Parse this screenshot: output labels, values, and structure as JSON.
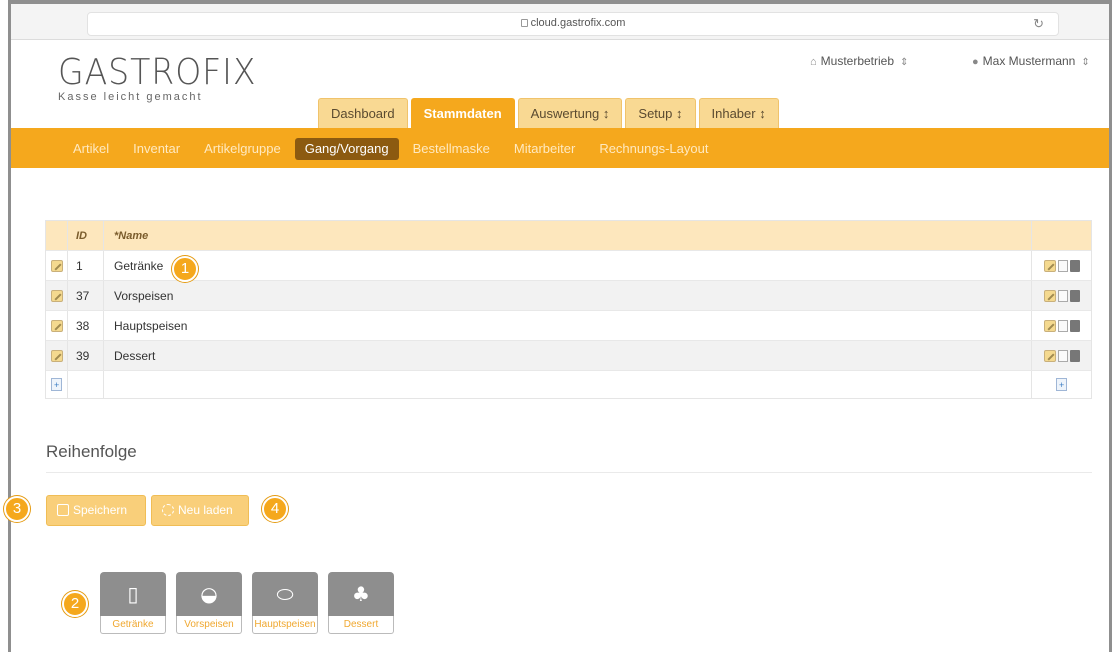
{
  "browser": {
    "url": "cloud.gastrofix.com"
  },
  "logo": {
    "name": "GASTROFIX",
    "tagline": "Kasse leicht gemacht"
  },
  "header": {
    "business": "Musterbetrieb",
    "user": "Max Mustermann"
  },
  "main_tabs": [
    {
      "label": "Dashboard"
    },
    {
      "label": "Stammdaten",
      "active": true
    },
    {
      "label": "Auswertung ↕"
    },
    {
      "label": "Setup ↕"
    },
    {
      "label": "Inhaber ↕"
    }
  ],
  "sub_nav": [
    {
      "label": "Artikel"
    },
    {
      "label": "Inventar"
    },
    {
      "label": "Artikelgruppe"
    },
    {
      "label": "Gang/Vorgang",
      "active": true
    },
    {
      "label": "Bestellmaske"
    },
    {
      "label": "Mitarbeiter"
    },
    {
      "label": "Rechnungs-Layout"
    }
  ],
  "table": {
    "columns": {
      "id": "ID",
      "name": "*Name"
    },
    "rows": [
      {
        "id": "1",
        "name": "Getränke"
      },
      {
        "id": "37",
        "name": "Vorspeisen"
      },
      {
        "id": "38",
        "name": "Hauptspeisen"
      },
      {
        "id": "39",
        "name": "Dessert"
      }
    ]
  },
  "order": {
    "title": "Reihenfolge",
    "save_label": "Speichern",
    "reload_label": "Neu laden",
    "tiles": [
      {
        "label": "Getränke",
        "icon": "glass-icon"
      },
      {
        "label": "Vorspeisen",
        "icon": "cheese-icon"
      },
      {
        "label": "Hauptspeisen",
        "icon": "steak-icon"
      },
      {
        "label": "Dessert",
        "icon": "cupcake-icon"
      }
    ]
  },
  "badges": {
    "b1": "1",
    "b2": "2",
    "b3": "3",
    "b4": "4"
  },
  "colors": {
    "accent": "#f5a81d",
    "accent_light": "#f9d993",
    "active_sub": "#8c5a10"
  }
}
